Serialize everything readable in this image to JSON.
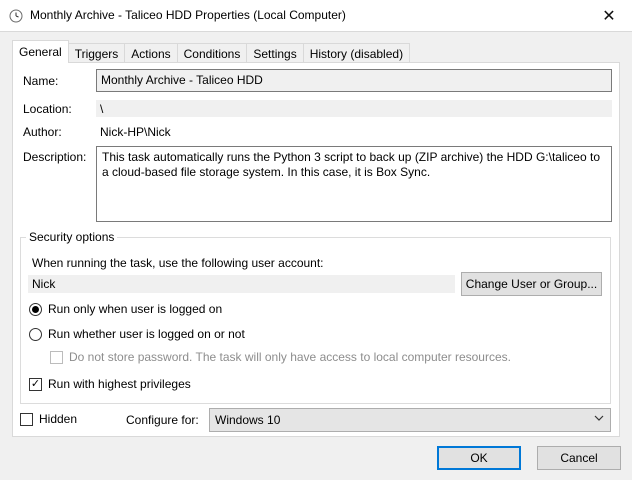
{
  "window": {
    "title": "Monthly Archive - Taliceo HDD Properties (Local Computer)",
    "close_glyph": "✕"
  },
  "tabs": [
    {
      "label": "General",
      "active": true
    },
    {
      "label": "Triggers"
    },
    {
      "label": "Actions"
    },
    {
      "label": "Conditions"
    },
    {
      "label": "Settings"
    },
    {
      "label": "History (disabled)"
    }
  ],
  "general": {
    "name_label": "Name:",
    "name_value": "Monthly Archive - Taliceo HDD",
    "location_label": "Location:",
    "location_value": "\\",
    "author_label": "Author:",
    "author_value": "Nick-HP\\Nick",
    "description_label": "Description:",
    "description_value": "This task automatically runs the Python 3 script to back up (ZIP archive) the HDD G:\\taliceo to a cloud-based file storage system.  In this case, it is Box Sync."
  },
  "security": {
    "group_title": "Security options",
    "account_prompt": "When running the task, use the following user account:",
    "account_value": "Nick",
    "change_button": "Change User or Group...",
    "radio_logged_on": "Run only when user is logged on",
    "radio_logged_on_checked": true,
    "radio_whether": "Run whether user is logged on or not",
    "radio_whether_checked": false,
    "do_not_store": "Do not store password.  The task will only have access to local computer resources.",
    "do_not_store_checked": false,
    "highest_privileges": "Run with highest privileges",
    "highest_privileges_checked": true
  },
  "bottom": {
    "hidden_label": "Hidden",
    "hidden_checked": false,
    "configure_label": "Configure for:",
    "configure_value": "Windows 10",
    "ok_button": "OK",
    "cancel_button": "Cancel"
  },
  "colors": {
    "accent": "#0078d7",
    "window_bg": "#f0f0f0",
    "panel_bg": "#ffffff"
  }
}
